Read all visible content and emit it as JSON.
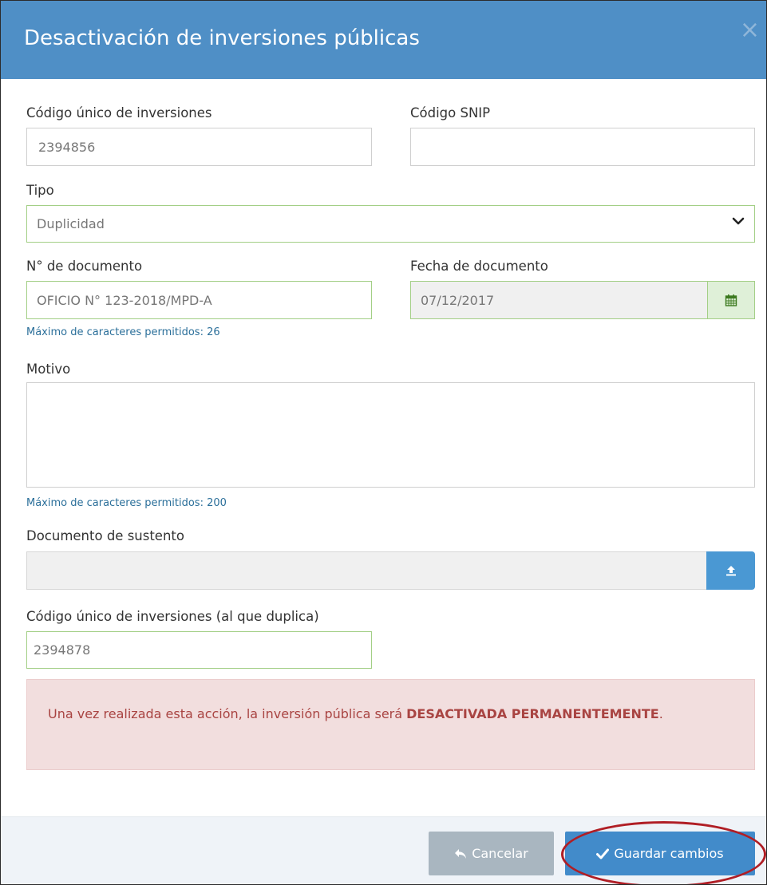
{
  "modal": {
    "title": "Desactivación de inversiones públicas",
    "close_symbol": "×"
  },
  "form": {
    "codigo_unico": {
      "label": "Código único de inversiones",
      "value": "2394856"
    },
    "codigo_snip": {
      "label": "Código SNIP",
      "value": ""
    },
    "tipo": {
      "label": "Tipo",
      "selected": "Duplicidad"
    },
    "nro_documento": {
      "label": "N° de documento",
      "value": "OFICIO N° 123-2018/MPD-A",
      "hint": "Máximo de caracteres permitidos: 26"
    },
    "fecha_documento": {
      "label": "Fecha de documento",
      "value": "07/12/2017"
    },
    "motivo": {
      "label": "Motivo",
      "value": "",
      "hint": "Máximo de caracteres permitidos: 200"
    },
    "documento_sustento": {
      "label": "Documento de sustento",
      "value": ""
    },
    "codigo_duplica": {
      "label": "Código único de inversiones (al que duplica)",
      "value": "2394878"
    }
  },
  "alert": {
    "text": "Una vez realizada esta acción, la inversión pública será ",
    "strong": "DESACTIVADA PERMANENTEMENTE",
    "end": "."
  },
  "footer": {
    "cancel_label": "Cancelar",
    "save_label": "Guardar cambios"
  },
  "icons": {
    "close": "close-icon",
    "select": "chevron-down-icon",
    "calendar": "calendar-icon",
    "upload": "upload-icon",
    "cancel": "reply-icon",
    "save": "check-icon"
  },
  "colors": {
    "header": "#4f8fc6",
    "valid_border": "#a3cf86",
    "alert_bg": "#f2dede",
    "alert_text": "#a94442",
    "save_button": "#428bca",
    "cancel_button": "#a9b6c0",
    "annotation": "#b01e25"
  }
}
